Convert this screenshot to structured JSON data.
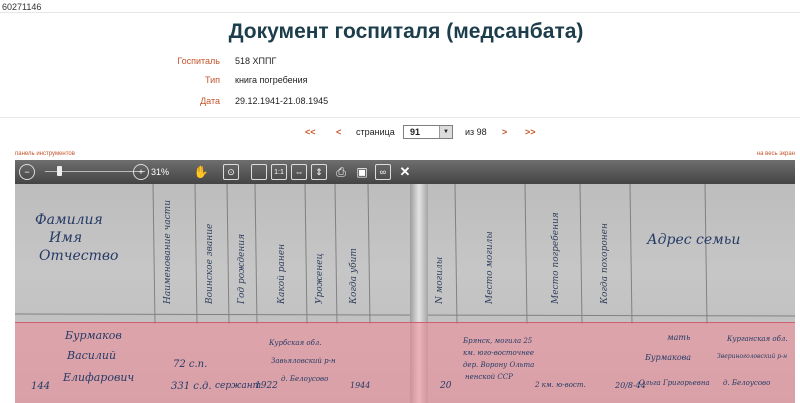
{
  "doc_id": "60271146",
  "title": "Документ госпиталя (медсанбата)",
  "meta": [
    {
      "label": "Госпиталь",
      "value": "518 ХППГ"
    },
    {
      "label": "Тип",
      "value": "книга погребения"
    },
    {
      "label": "Дата",
      "value": "29.12.1941-21.08.1945"
    }
  ],
  "pager": {
    "first": "<<",
    "prev": "<",
    "page_word": "страница",
    "current": "91",
    "of_word": "из 98",
    "next": ">",
    "last": ">>"
  },
  "viewer": {
    "panel_link": "панель инструментов",
    "fullscreen_link": "на весь экран",
    "zoom": "31%"
  },
  "scan_text": {
    "header_name": [
      "Фамилия",
      "Имя",
      "Отчество"
    ],
    "header_cols": [
      "Наименование части",
      "Воинское звание",
      "Год рождения",
      "Какой ранен",
      "Уроженец",
      "Когда убит",
      "N могилы",
      "Место могилы",
      "Место погребения",
      "Когда похоронен"
    ],
    "header_address": "Адрес семьи",
    "row_number": "144",
    "row_name": [
      "Бурмаков",
      "Василий",
      "Елифарович"
    ],
    "row_unit": [
      "72 с.п.",
      "331 с.д."
    ],
    "row_rank": "сержант",
    "row_year": "1922",
    "row_origin": [
      "Курбская обл.",
      "Завьяловский р-н",
      "д. Белоусово"
    ],
    "row_date": "1944",
    "row_grave": "20",
    "row_place": [
      "Брянск, могила 25",
      "км. юго-восточнее",
      "дер. Ворону Ольта",
      "ненской ССР"
    ],
    "row_buried": "2 км. ю-вост.",
    "row_when": "20/8-44",
    "row_family": [
      "мать",
      "Бурмакова",
      "Ольга Григорьевна"
    ],
    "row_family_addr": [
      "Курганская обл.",
      "Звериноголовский р-н",
      "д. Белоусово"
    ]
  }
}
